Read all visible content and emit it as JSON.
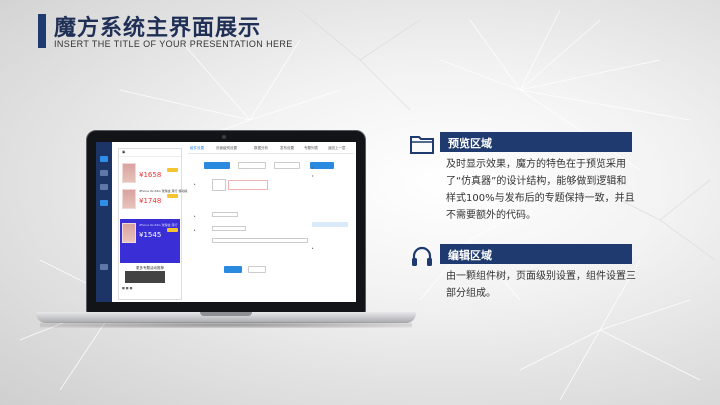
{
  "header": {
    "title": "魔方系统主界面展示",
    "subtitle": "INSERT THE TITLE OF YOUR PRESENTATION HERE"
  },
  "sections": [
    {
      "icon": "folder-icon",
      "heading": "预览区域",
      "body": "及时显示效果，魔方的特色在于预览采用了“仿真器”的设计结构，能够做到逻辑和样式100%与发布后的专题保持一致，并且不需要额外的代码。"
    },
    {
      "icon": "headphones-icon",
      "heading": "编辑区域",
      "body": "由一颗组件树，页面级别设置，组件设置三部分组成。"
    }
  ],
  "screen": {
    "products": [
      {
        "name": "iPhone 6s 64G 玫瑰金 港行",
        "price": "¥1658"
      },
      {
        "name": "iPhone 6s 64G 玫瑰金 港行 移动版",
        "price": "¥1748"
      },
      {
        "name": "iPhone 6s 64G 玫瑰金 港行",
        "price": "¥1545"
      }
    ],
    "section_title": "更多专题活动推荐",
    "tabs": [
      "组件设置",
      "页面级别设置",
      "数据分析",
      "发布设置",
      "专题列表",
      "返回上一层"
    ]
  },
  "colors": {
    "brand": "#1f3a6e",
    "accent": "#2a8ae0",
    "price": "#e33333"
  }
}
